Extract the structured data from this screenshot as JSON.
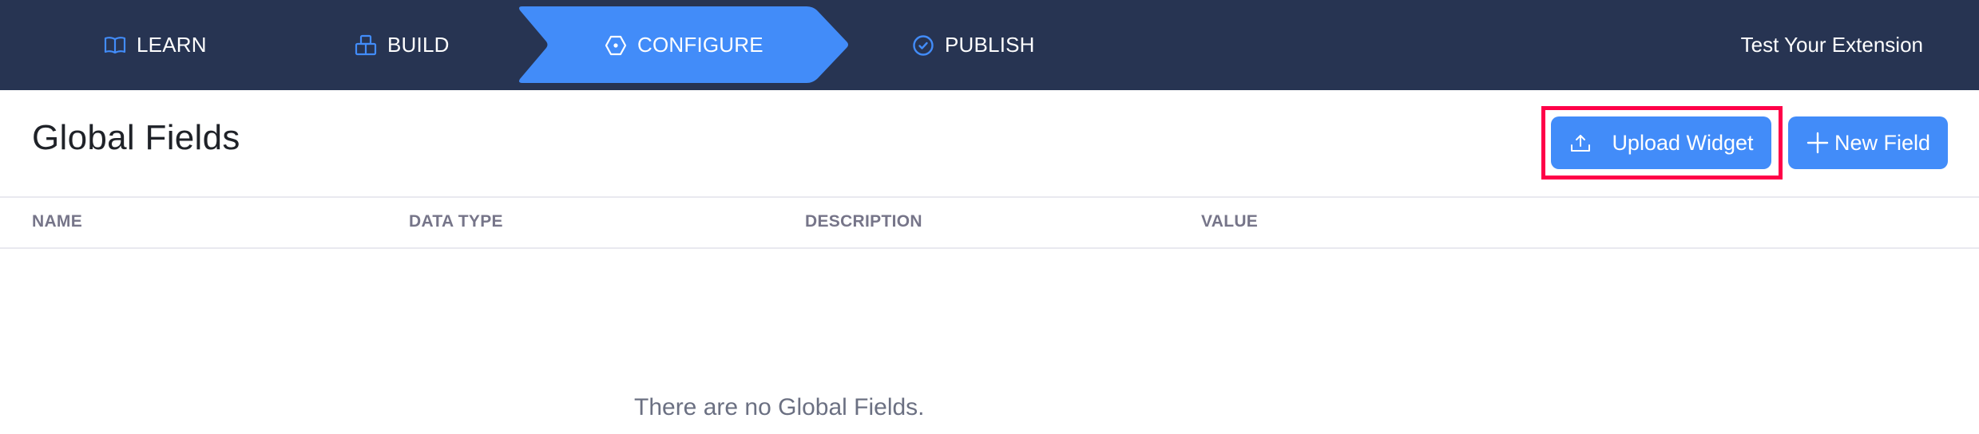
{
  "topbar": {
    "steps": [
      {
        "label": "LEARN",
        "icon": "book-icon",
        "active": false
      },
      {
        "label": "BUILD",
        "icon": "blocks-icon",
        "active": false
      },
      {
        "label": "CONFIGURE",
        "icon": "hexagon-icon",
        "active": true
      },
      {
        "label": "PUBLISH",
        "icon": "check-circle-icon",
        "active": false
      }
    ],
    "test_extension_label": "Test Your Extension"
  },
  "page": {
    "title": "Global Fields",
    "upload_widget_label": "Upload Widget",
    "new_field_label": "New Field"
  },
  "table": {
    "columns": [
      "NAME",
      "DATA TYPE",
      "DESCRIPTION",
      "VALUE"
    ],
    "rows": [],
    "empty_message": "There are no Global Fields."
  },
  "colors": {
    "topbar_bg": "#273452",
    "accent": "#428cf9",
    "highlight": "#ff0048"
  }
}
